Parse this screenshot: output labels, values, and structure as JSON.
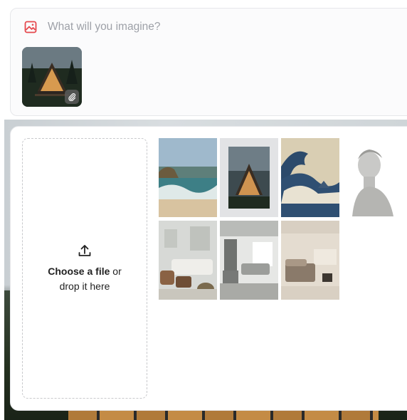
{
  "prompt": {
    "placeholder": "What will you imagine?",
    "attachment_icon": "paperclip-icon"
  },
  "upload": {
    "choose_label": "Choose a file",
    "or_label": " or",
    "drop_label": "drop it here"
  },
  "gallery": {
    "items": [
      {
        "name": "beach-waves-image"
      },
      {
        "name": "a-frame-cabin-image",
        "selected": true
      },
      {
        "name": "great-wave-image"
      },
      {
        "name": "greek-bust-image"
      },
      {
        "name": "living-room-image"
      },
      {
        "name": "loft-interior-image"
      },
      {
        "name": "bedroom-image"
      }
    ]
  },
  "colors": {
    "accent": "#e5484d"
  }
}
